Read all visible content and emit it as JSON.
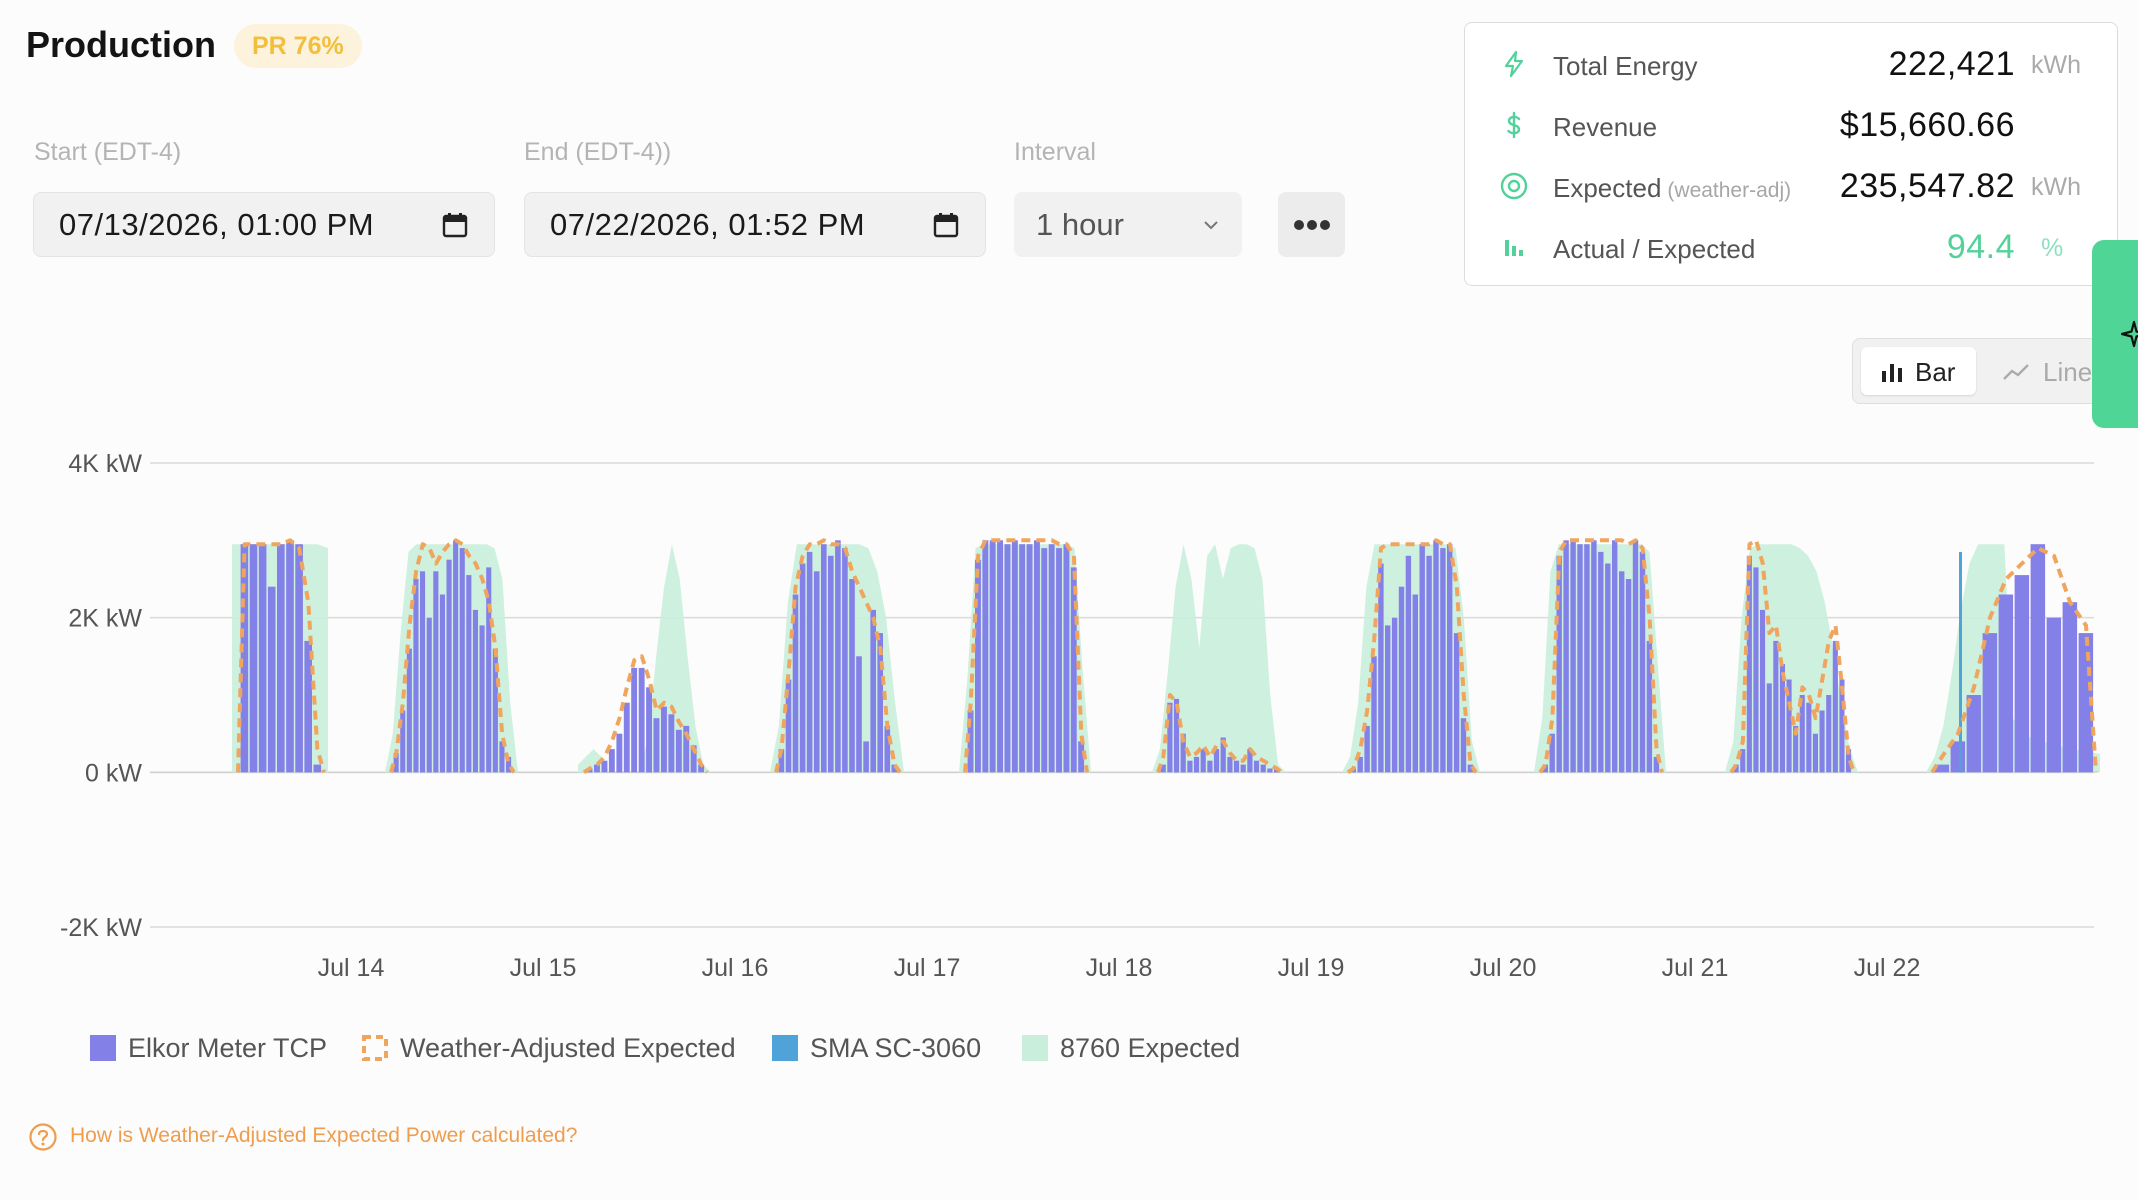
{
  "header": {
    "title": "Production",
    "badge": "PR 76%"
  },
  "filters": {
    "start_label": "Start (EDT-4)",
    "start_value": "07/13/2026, 01:00 PM",
    "end_label": "End (EDT-4))",
    "end_value": "07/22/2026, 01:52 PM",
    "interval_label": "Interval",
    "interval_value": "1 hour"
  },
  "summary": {
    "total_energy": {
      "label": "Total Energy",
      "value": "222,421",
      "unit": "kWh",
      "icon": "bolt-icon"
    },
    "revenue": {
      "label": "Revenue",
      "value": "$15,660.66",
      "icon": "dollar-icon"
    },
    "expected": {
      "label": "Expected",
      "sublabel": "(weather-adj)",
      "value": "235,547.82",
      "unit": "kWh",
      "icon": "target-icon"
    },
    "ratio": {
      "label": "Actual / Expected",
      "value": "94.4",
      "unit": "%",
      "icon": "bar-chart-icon"
    }
  },
  "view_toggle": {
    "bar_label": "Bar",
    "line_label": "Line",
    "selected": "bar"
  },
  "colors": {
    "meter": "#8380e8",
    "weather": "#f0a55e",
    "sma": "#4fa3d9",
    "expected8760": "#c9eedb",
    "accent": "#4fd696"
  },
  "chart_data": {
    "type": "bar",
    "y_ticks": [
      "4K kW",
      "2K kW",
      "0 kW",
      "-2K kW"
    ],
    "ylim": [
      -2000,
      4000
    ],
    "x_ticks": [
      "Jul 14",
      "Jul 15",
      "Jul 16",
      "Jul 17",
      "Jul 18",
      "Jul 19",
      "Jul 20",
      "Jul 21",
      "Jul 22"
    ],
    "grid": true,
    "legend_position": "bottom-left",
    "series": [
      {
        "name": "Elkor Meter TCP",
        "type": "bar"
      },
      {
        "name": "Weather-Adjusted Expected",
        "type": "line-dashed"
      },
      {
        "name": "SMA SC-3060",
        "type": "bar"
      },
      {
        "name": "8760 Expected",
        "type": "area"
      }
    ],
    "days": [
      {
        "label": "Jul 13",
        "meter": [
          2950,
          2950,
          2950,
          2400,
          2950,
          3000,
          2950,
          1700,
          100
        ],
        "weather": [
          2950,
          2950,
          2950,
          2950,
          2950,
          3000,
          2900,
          2200,
          300
        ],
        "expected8760": [
          2950,
          2950,
          2950,
          2950,
          2950,
          2950,
          2950,
          2950,
          2950,
          2900
        ]
      },
      {
        "label": "Jul 14",
        "meter": [
          250,
          800,
          1600,
          2500,
          2600,
          2000,
          2600,
          2300,
          2750,
          3000,
          2900,
          2550,
          2100,
          1900,
          2650,
          1600,
          400,
          200
        ],
        "weather": [
          250,
          900,
          1900,
          2600,
          2950,
          2900,
          2700,
          2850,
          2950,
          3000,
          2950,
          2800,
          2700,
          2500,
          2200,
          1600,
          500,
          100
        ],
        "expected8760": [
          0,
          500,
          1800,
          2850,
          2950,
          2950,
          2950,
          2950,
          2950,
          2950,
          2950,
          2950,
          2950,
          2950,
          2900,
          2500,
          900,
          0
        ]
      },
      {
        "label": "Jul 15",
        "meter": [
          50,
          100,
          150,
          300,
          500,
          900,
          1350,
          1350,
          1100,
          700,
          850,
          750,
          550,
          600,
          350,
          100
        ],
        "weather": [
          50,
          100,
          200,
          400,
          700,
          1100,
          1450,
          1500,
          1200,
          800,
          900,
          850,
          650,
          500,
          300,
          100
        ],
        "expected8760": [
          100,
          200,
          300,
          200,
          0,
          0,
          0,
          0,
          0,
          500,
          1500,
          2400,
          2950,
          2500,
          1500,
          600,
          100,
          0
        ]
      },
      {
        "label": "Jul 16",
        "meter": [
          300,
          1200,
          2300,
          2700,
          2850,
          2600,
          2950,
          2800,
          3000,
          2900,
          2500,
          1500,
          400,
          2100,
          1800,
          600,
          100
        ],
        "weather": [
          300,
          1300,
          2400,
          2800,
          2950,
          2950,
          3000,
          2950,
          2950,
          2900,
          2600,
          2400,
          2200,
          2000,
          1600,
          600,
          100
        ],
        "expected8760": [
          0,
          600,
          2200,
          2950,
          2950,
          2950,
          2950,
          2950,
          2950,
          2950,
          2950,
          2900,
          2600,
          2000,
          900,
          0
        ]
      },
      {
        "label": "Jul 17",
        "meter": [
          800,
          2750,
          3000,
          3000,
          3000,
          2950,
          3000,
          2950,
          2950,
          3000,
          2900,
          2950,
          2900,
          2950,
          2650,
          400
        ],
        "weather": [
          900,
          2800,
          3000,
          3000,
          3000,
          3000,
          3000,
          3000,
          3000,
          3000,
          3000,
          3000,
          2950,
          2950,
          2800,
          500
        ],
        "expected8760": [
          0,
          1200,
          2900,
          2950,
          2950,
          2950,
          2950,
          2950,
          2950,
          2950,
          2950,
          2950,
          2950,
          2950,
          2900,
          1300,
          0
        ]
      },
      {
        "label": "Jul 18",
        "meter": [
          100,
          900,
          950,
          500,
          150,
          200,
          300,
          150,
          300,
          450,
          200,
          150,
          100,
          300,
          150,
          100,
          50,
          50
        ],
        "weather": [
          200,
          1000,
          900,
          400,
          200,
          250,
          350,
          200,
          350,
          400,
          250,
          150,
          150,
          300,
          200,
          150,
          100,
          50
        ],
        "expected8760": [
          0,
          300,
          1300,
          2400,
          2950,
          2500,
          1600,
          2800,
          2950,
          2500,
          2900,
          2950,
          2950,
          2900,
          2500,
          1000,
          100,
          0
        ]
      },
      {
        "label": "Jul 19",
        "meter": [
          50,
          200,
          600,
          1500,
          2700,
          1900,
          2000,
          2400,
          2800,
          2300,
          2950,
          2800,
          3000,
          2900,
          2950,
          1800,
          700,
          100
        ],
        "weather": [
          50,
          300,
          800,
          1700,
          2900,
          2950,
          2950,
          2950,
          2950,
          2950,
          2950,
          2950,
          3000,
          2950,
          2950,
          2400,
          1000,
          100
        ],
        "expected8760": [
          0,
          200,
          900,
          2400,
          2950,
          2950,
          2950,
          2950,
          2950,
          2950,
          2950,
          2950,
          2950,
          2950,
          2900,
          2000,
          400,
          0
        ]
      },
      {
        "label": "Jul 20",
        "meter": [
          100,
          500,
          2800,
          3000,
          3000,
          2950,
          2950,
          3000,
          2850,
          2700,
          3000,
          2600,
          2500,
          3000,
          2850,
          1700,
          200
        ],
        "weather": [
          100,
          700,
          2850,
          3000,
          3000,
          3000,
          3000,
          3000,
          3000,
          3000,
          3000,
          3000,
          2950,
          3000,
          2900,
          2000,
          300
        ],
        "expected8760": [
          0,
          700,
          2600,
          2950,
          2950,
          2950,
          2950,
          2950,
          2950,
          2950,
          2950,
          2950,
          2950,
          2950,
          2850,
          1400,
          0
        ]
      },
      {
        "label": "Jul 21",
        "meter": [
          100,
          300,
          2800,
          2650,
          2100,
          1150,
          1700,
          1400,
          1200,
          600,
          1000,
          900,
          500,
          800,
          1000,
          1700,
          1200,
          300
        ],
        "weather": [
          100,
          400,
          2950,
          3000,
          2700,
          1800,
          1900,
          1300,
          900,
          500,
          1100,
          1000,
          700,
          1200,
          1700,
          1900,
          1100,
          200
        ],
        "expected8760": [
          0,
          400,
          2000,
          2900,
          2950,
          2950,
          2950,
          2950,
          2950,
          2900,
          2800,
          2600,
          2200,
          1600,
          900,
          300,
          0
        ]
      },
      {
        "label": "Jul 22",
        "meter": [
          100,
          400,
          1000,
          1800,
          2300,
          2550,
          2950,
          2000,
          2200,
          1800
        ],
        "weather": [
          200,
          500,
          1100,
          2000,
          2500,
          2700,
          2900,
          2800,
          2200,
          1900
        ],
        "expected8760": [
          0,
          200,
          600,
          1300,
          2100,
          2700,
          2950,
          2950,
          2950,
          2950,
          700,
          500,
          450,
          420,
          380,
          350,
          320,
          300,
          280,
          260,
          240
        ]
      }
    ]
  },
  "help_link": "How is Weather-Adjusted Expected Power calculated?"
}
